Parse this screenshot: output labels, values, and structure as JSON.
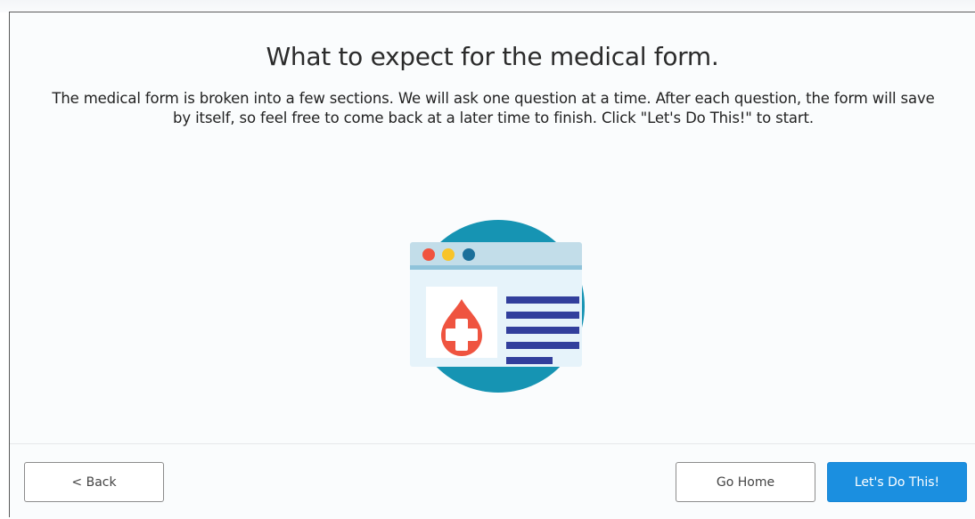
{
  "intro": {
    "title": "What to expect for the medical form.",
    "description_line1": "The medical form is broken into a few sections. We will ask one question at a time. After each question, the form will save",
    "description_line2": "by itself, so feel free to come back at a later time to finish. Click \"Let's Do This!\" to start."
  },
  "illustration": {
    "icon": "medical-form-illustration",
    "colors": {
      "circle": "#1694b3",
      "window": "#e6f3fa",
      "titlebar": "#c2dde9",
      "dot_red": "#f0533f",
      "dot_yellow": "#f8c42a",
      "dot_blue": "#1b6f9a",
      "drop": "#ef5440",
      "lines": "#323f9c"
    }
  },
  "footer": {
    "back_label": "< Back",
    "home_label": "Go Home",
    "start_label": "Let's Do This!"
  }
}
